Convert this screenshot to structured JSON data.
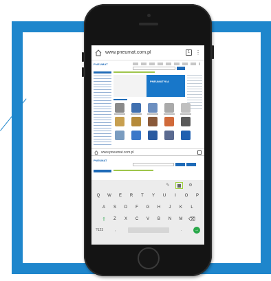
{
  "colors": {
    "frame_blue": "#1e86cc",
    "phone_black": "#141414",
    "accent_green": "#9fd23c",
    "brand_blue": "#1877c9"
  },
  "browser": {
    "home_icon": "home-icon",
    "url": "www.pneumat.com.pl",
    "tabs_count": "1",
    "menu_icon": "⋮"
  },
  "page": {
    "logo_text": "PNEUMAT",
    "hero_text": "PNEUMATYKA"
  },
  "second_tab": {
    "url": "www.pneumat.com.pl"
  },
  "keyboard": {
    "suggest_icons": [
      "✎",
      "⚙"
    ],
    "rows": [
      [
        "Q",
        "W",
        "E",
        "R",
        "T",
        "Y",
        "U",
        "I",
        "O",
        "P"
      ],
      [
        "A",
        "S",
        "D",
        "F",
        "G",
        "H",
        "J",
        "K",
        "L"
      ],
      [
        "⇧",
        "Z",
        "X",
        "C",
        "V",
        "B",
        "N",
        "M",
        "⌫"
      ]
    ],
    "bottom": {
      "left": "?123",
      "comma": ",",
      "period": ".",
      "go": "→"
    }
  }
}
